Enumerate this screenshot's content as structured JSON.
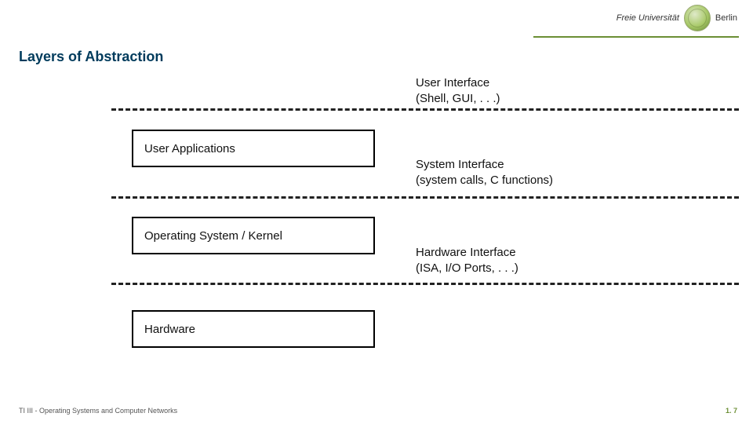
{
  "header": {
    "institution_prefix": "Freie Universität",
    "institution_suffix": "Berlin"
  },
  "title": "Layers of Abstraction",
  "interfaces": [
    {
      "line1": "User Interface",
      "line2": "(Shell, GUI, . . .)"
    },
    {
      "line1": "System Interface",
      "line2": "(system calls, C functions)"
    },
    {
      "line1": "Hardware Interface",
      "line2": "(ISA, I/O Ports, . . .)"
    }
  ],
  "layers": [
    {
      "name": "User Applications"
    },
    {
      "name": "Operating System / Kernel"
    },
    {
      "name": "Hardware"
    }
  ],
  "footer": {
    "left": "TI III - Operating Systems and Computer Networks",
    "right": "1. 7"
  }
}
